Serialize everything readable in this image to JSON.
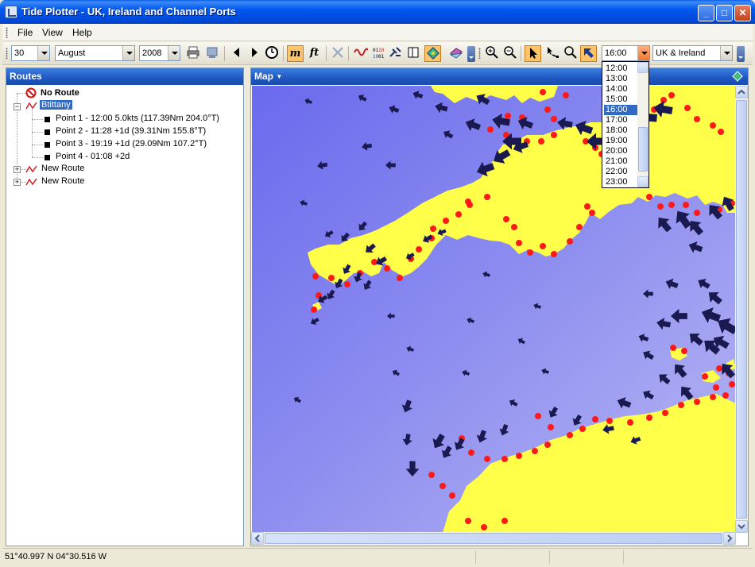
{
  "window": {
    "title": "Tide Plotter - UK, Ireland and Channel Ports",
    "minimize_icon": "minimize-icon",
    "maximize_icon": "maximize-icon",
    "close_icon": "close-icon"
  },
  "menu": {
    "items": [
      "File",
      "View",
      "Help"
    ]
  },
  "toolbar": {
    "day": "30",
    "month": "August",
    "year": "2008",
    "time": "16:00",
    "region": "UK & Ireland",
    "units_m": "m",
    "units_ft": "ft"
  },
  "routes": {
    "title": "Routes",
    "no_route": "No Route",
    "route_name": "Btittany",
    "points": [
      "Point 1 - 12:00 5.0kts  (117.39Nm  204.0°T)",
      "Point 2 - 11:28 +1d (39.31Nm  155.8°T)",
      "Point 3 - 19:19 +1d (29.09Nm  107.2°T)",
      "Point 4 - 01:08 +2d"
    ],
    "other_routes": [
      "New Route",
      "New Route"
    ]
  },
  "map": {
    "title": "Map",
    "sea_color": "#8C8CF0",
    "land_color": "#FFFF4A",
    "port_color": "#FF1A1A",
    "arrow_color": "#1A1A50"
  },
  "time_list": {
    "items": [
      "12:00",
      "13:00",
      "14:00",
      "15:00",
      "16:00",
      "17:00",
      "18:00",
      "19:00",
      "20:00",
      "21:00",
      "22:00",
      "23:00"
    ],
    "selected": "16:00"
  },
  "status": {
    "coordinates": "51°40.997 N  04°30.516 W"
  }
}
